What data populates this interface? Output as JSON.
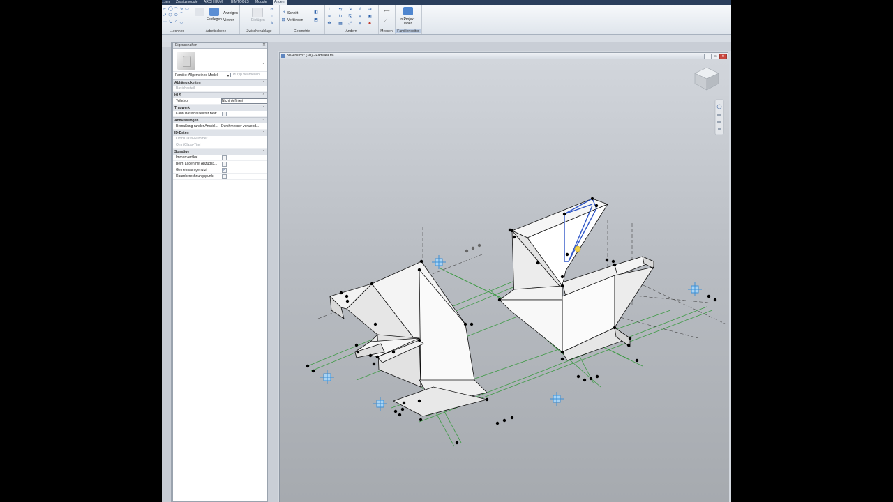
{
  "ribbon": {
    "tabs": [
      "...ten",
      "Zusatzmodule",
      "ARCHIHUM",
      "BIMTOOLS",
      "Module",
      "Ändern"
    ],
    "active_tab": "Ändern",
    "panels": {
      "zeichnen": "...echnen",
      "arbeitsebene": "Arbeitsebene",
      "zwischenablage": "Zwischenablage",
      "geometrie": "Geometrie",
      "aendern": "Ändern",
      "messen": "Messen",
      "familieneditor": "Familieneditor"
    },
    "buttons": {
      "festlegen": "Festlegen",
      "anzeigen": "Anzeigen",
      "viewer": "Viewer",
      "einfuegen": "Einfügen",
      "schnitt": "Schnitt",
      "verbinden": "Verbinden",
      "in_projekt": "In Projekt",
      "laden": "laden"
    }
  },
  "properties": {
    "title": "Eigenschaften",
    "family_selector": "Familie: Allgemeines Modell",
    "type_edit": "Typ bearbeiten",
    "groups": [
      {
        "name": "Abhängigkeiten",
        "rows": [
          {
            "label": "Basisbauteil",
            "value": "",
            "disabled": true
          }
        ]
      },
      {
        "name": "HLS",
        "rows": [
          {
            "label": "Teiletyp",
            "value": "Nicht definiert",
            "boxed": true
          }
        ]
      },
      {
        "name": "Tragwerk",
        "rows": [
          {
            "label": "Kann Basisbauteil für Bew...",
            "checkbox": false
          }
        ]
      },
      {
        "name": "Abmessungen",
        "rows": [
          {
            "label": "Bemaßung runder Anschl...",
            "value": "Durchmesser verwend..."
          }
        ]
      },
      {
        "name": "ID-Daten",
        "rows": [
          {
            "label": "OmniClass-Nummer",
            "value": "",
            "disabled": true
          },
          {
            "label": "OmniClass-Titel",
            "value": "",
            "disabled": true
          }
        ]
      },
      {
        "name": "Sonstige",
        "rows": [
          {
            "label": "Immer vertikal",
            "checkbox": false
          },
          {
            "label": "Beim Laden mit Abzugsk...",
            "checkbox": false
          },
          {
            "label": "Gemeinsam genutzt",
            "checkbox": true
          },
          {
            "label": "Raumberechnungspunkt",
            "checkbox": false
          }
        ]
      }
    ]
  },
  "view": {
    "title": "3D-Ansicht: {3D} - Familie9.rfa",
    "win_controls": [
      "–",
      "▭",
      "✕"
    ]
  }
}
